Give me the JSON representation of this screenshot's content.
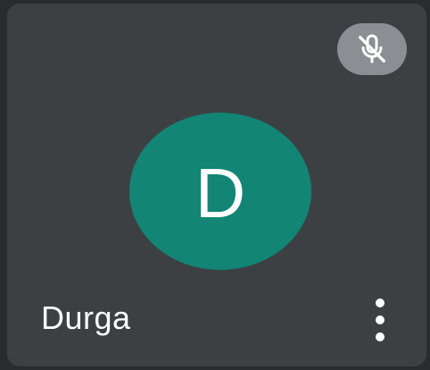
{
  "participant": {
    "initial": "D",
    "name": "Durga",
    "avatar_color": "#128575"
  },
  "status": {
    "mic_icon": "mic-off-icon",
    "mic_muted": true
  },
  "controls": {
    "more_icon": "more-vert-icon"
  },
  "colors": {
    "tile_background": "#3c4043",
    "mic_badge_background": "#8b8e92",
    "text": "#ffffff"
  }
}
